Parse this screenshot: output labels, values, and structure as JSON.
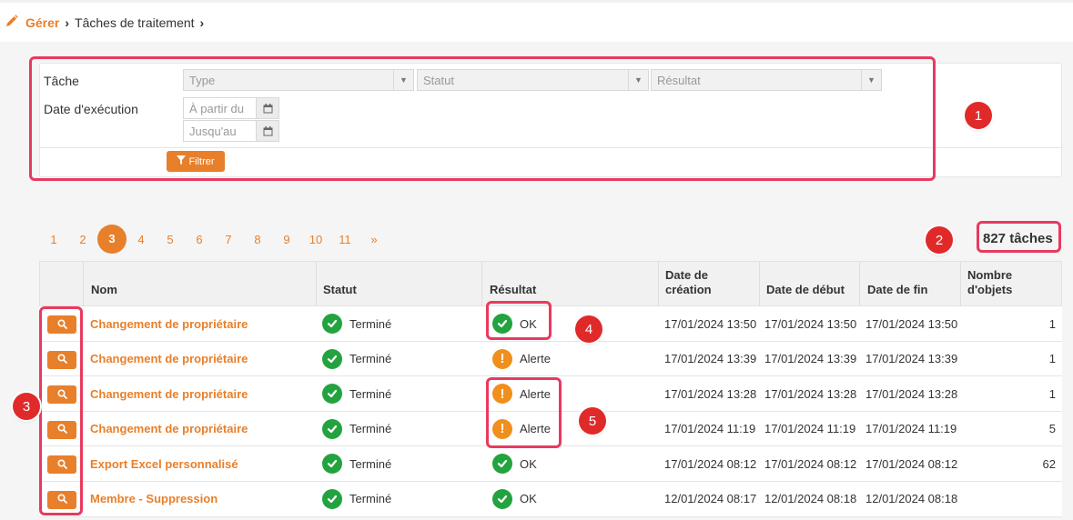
{
  "breadcrumb": {
    "edit_icon": "pencil-icon",
    "parent": "Gérer",
    "current": "Tâches de traitement"
  },
  "filters": {
    "task_label": "Tâche",
    "date_label": "Date d'exécution",
    "type_placeholder": "Type",
    "status_placeholder": "Statut",
    "result_placeholder": "Résultat",
    "from_placeholder": "À partir du",
    "to_placeholder": "Jusqu'au",
    "filter_button": "Filtrer"
  },
  "badges": [
    "1",
    "2",
    "3",
    "4",
    "5"
  ],
  "pagination": {
    "pages": [
      "1",
      "2",
      "3",
      "4",
      "5",
      "6",
      "7",
      "8",
      "9",
      "10",
      "11",
      "»"
    ],
    "active": "3"
  },
  "task_count": "827 tâches",
  "table": {
    "columns": {
      "name": "Nom",
      "status": "Statut",
      "result": "Résultat",
      "created_1": "Date de",
      "created_2": "création",
      "start": "Date de début",
      "end": "Date de fin",
      "objects_1": "Nombre",
      "objects_2": "d'objets"
    },
    "rows": [
      {
        "name": "Changement de propriétaire",
        "status": "Terminé",
        "result": "OK",
        "result_type": "ok",
        "created": "17/01/2024 13:50",
        "start": "17/01/2024 13:50",
        "end": "17/01/2024 13:50",
        "objects": "1"
      },
      {
        "name": "Changement de propriétaire",
        "status": "Terminé",
        "result": "Alerte",
        "result_type": "warn",
        "created": "17/01/2024 13:39",
        "start": "17/01/2024 13:39",
        "end": "17/01/2024 13:39",
        "objects": "1"
      },
      {
        "name": "Changement de propriétaire",
        "status": "Terminé",
        "result": "Alerte",
        "result_type": "warn",
        "created": "17/01/2024 13:28",
        "start": "17/01/2024 13:28",
        "end": "17/01/2024 13:28",
        "objects": "1"
      },
      {
        "name": "Changement de propriétaire",
        "status": "Terminé",
        "result": "Alerte",
        "result_type": "warn",
        "created": "17/01/2024 11:19",
        "start": "17/01/2024 11:19",
        "end": "17/01/2024 11:19",
        "objects": "5"
      },
      {
        "name": "Export Excel personnalisé",
        "status": "Terminé",
        "result": "OK",
        "result_type": "ok",
        "created": "17/01/2024 08:12",
        "start": "17/01/2024 08:12",
        "end": "17/01/2024 08:12",
        "objects": "62"
      },
      {
        "name": "Membre - Suppression",
        "status": "Terminé",
        "result": "OK",
        "result_type": "ok",
        "created": "12/01/2024 08:17",
        "start": "12/01/2024 08:18",
        "end": "12/01/2024 08:18",
        "objects": ""
      }
    ]
  },
  "colors": {
    "accent": "#e87f2a",
    "highlight": "#e83a5f",
    "badge": "#e02a2a",
    "ok": "#23a33f",
    "warn": "#f08f1c"
  }
}
